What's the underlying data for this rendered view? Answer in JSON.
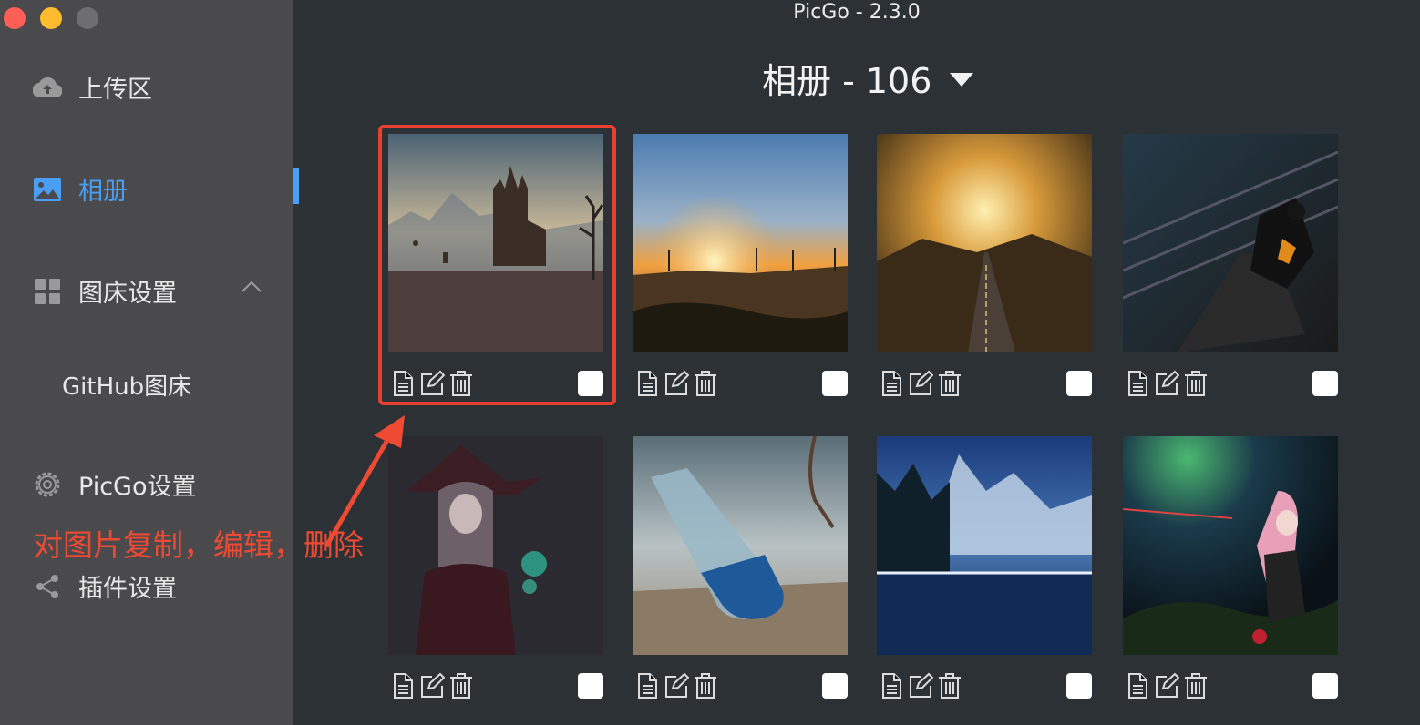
{
  "window": {
    "title": "PicGo - 2.3.0"
  },
  "sidebar": {
    "items": [
      {
        "label": "上传区",
        "icon": "cloud-upload-icon"
      },
      {
        "label": "相册",
        "icon": "image-icon",
        "active": true
      },
      {
        "label": "图床设置",
        "icon": "grid-icon",
        "expanded": true
      },
      {
        "label": "GitHub图床"
      },
      {
        "label": "PicGo设置",
        "icon": "gear-icon"
      },
      {
        "label": "插件设置",
        "icon": "share-icon"
      }
    ]
  },
  "gallery": {
    "title": "相册 - 106",
    "images": [
      {
        "subject": "gothic-abbey-ruins",
        "selected": false
      },
      {
        "subject": "sunset-wind-turbines",
        "selected": false
      },
      {
        "subject": "golden-sky-road",
        "selected": false
      },
      {
        "subject": "anime-girl-railway",
        "selected": false
      },
      {
        "subject": "witch-girl-green-flame",
        "selected": false
      },
      {
        "subject": "bottle-dolphin-desert",
        "selected": false
      },
      {
        "subject": "snowy-mountain-lake",
        "selected": false
      },
      {
        "subject": "anime-girl-forest",
        "selected": false
      }
    ]
  },
  "annotation": {
    "text": "对图片复制，编辑，删除"
  },
  "colors": {
    "accent": "#4a9ff5",
    "annotation": "#ee4a33",
    "sidebar_bg": "#4a4a4c",
    "main_bg": "#2c3135"
  }
}
